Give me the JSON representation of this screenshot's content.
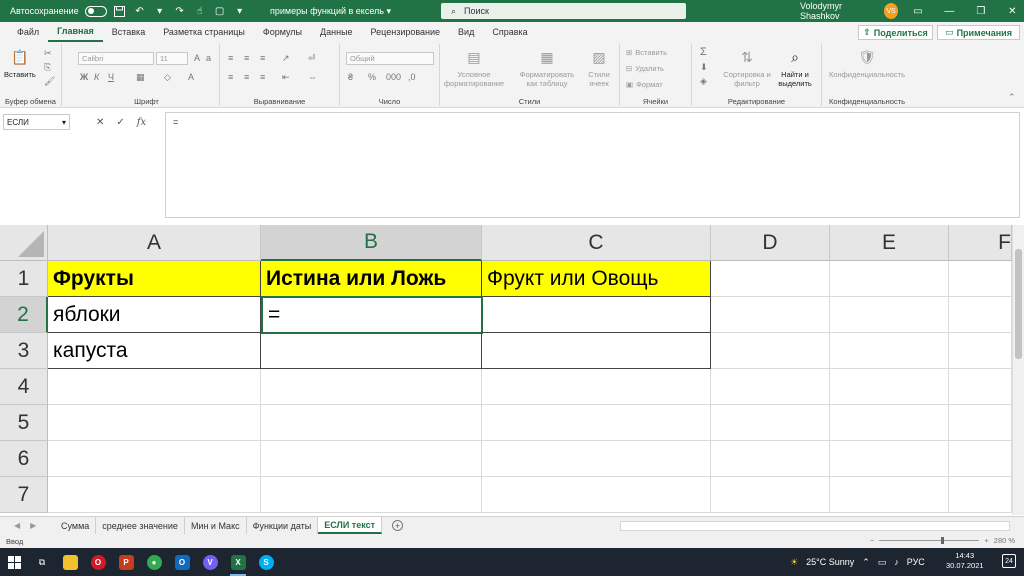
{
  "titlebar": {
    "autosave_label": "Автосохранение",
    "doc_title": "примеры функций в ексель",
    "search_placeholder": "Поиск",
    "user_name": "Volodymyr Shashkov",
    "user_initials": "VS"
  },
  "ribbon_tabs": [
    "Файл",
    "Главная",
    "Вставка",
    "Разметка страницы",
    "Формулы",
    "Данные",
    "Рецензирование",
    "Вид",
    "Справка"
  ],
  "active_tab": "Главная",
  "share_label": "Поделиться",
  "notes_label": "Примечания",
  "ribbon": {
    "clipboard": {
      "paste": "Вставить",
      "label": "Буфер обмена"
    },
    "font": {
      "font_name": "Calibri",
      "font_size": "11",
      "label": "Шрифт"
    },
    "alignment": {
      "label": "Выравнивание"
    },
    "number": {
      "format": "Общий",
      "label": "Число"
    },
    "styles": {
      "conditional": "Условное форматирование",
      "as_table": "Форматировать как таблицу",
      "cell_styles": "Стили ячеек",
      "label": "Стили"
    },
    "cells": {
      "insert": "Вставить",
      "delete": "Удалить",
      "format": "Формат",
      "label": "Ячейки"
    },
    "editing": {
      "sort": "Сортировка и фильтр",
      "find": "Найти и выделить",
      "label": "Редактирование"
    },
    "sensitivity": {
      "btn": "Конфиденциальность",
      "label": "Конфиденциальность"
    }
  },
  "formula_bar": {
    "name_box": "ЕСЛИ",
    "formula": "="
  },
  "columns": [
    "A",
    "B",
    "C",
    "D",
    "E",
    "F"
  ],
  "rows": [
    "1",
    "2",
    "3",
    "4",
    "5",
    "6",
    "7"
  ],
  "cells": {
    "A1": "Фрукты",
    "B1": "Истина или Ложь",
    "C1": "Фрукт или Овощь",
    "A2": "яблоки",
    "B2": "=",
    "A3": "капуста"
  },
  "sheets": [
    "Сумма",
    "среднее значение",
    "Мин и Макс",
    "Функции даты",
    "ЕСЛИ текст"
  ],
  "active_sheet": "ЕСЛИ текст",
  "status": {
    "mode": "Ввод",
    "zoom": "280 %"
  },
  "taskbar": {
    "weather": "25°C  Sunny",
    "lang": "РУС",
    "time": "14:43",
    "date": "30.07.2021",
    "notifications": "24"
  },
  "colors": {
    "excel_green": "#217346",
    "header_yellow": "#ffff00"
  }
}
